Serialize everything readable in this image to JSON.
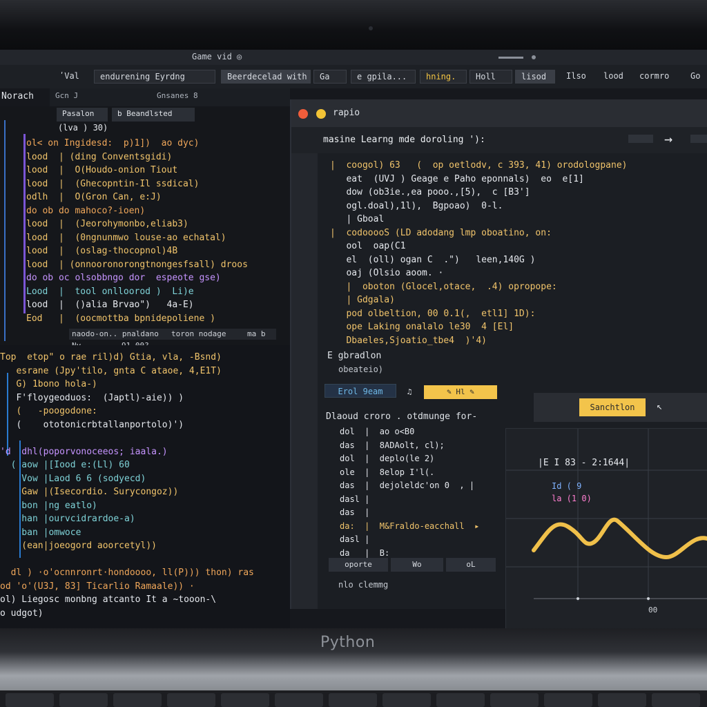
{
  "window": {
    "title": "Game vid ◎"
  },
  "menubar": {
    "items": [
      {
        "label": "ʹVal"
      },
      {
        "label": "endurening  Eyrdng"
      },
      {
        "label": "Beerdecelad with"
      },
      {
        "label": "Ga"
      },
      {
        "label": "e gpila..."
      },
      {
        "label": "hning."
      },
      {
        "label": "Holl"
      },
      {
        "label": "lisod"
      },
      {
        "label": "Ilso"
      },
      {
        "label": "lood"
      },
      {
        "label": "cormro"
      },
      {
        "label": "Go"
      }
    ]
  },
  "left_header": {
    "label": "Norach"
  },
  "left_toolbar": {
    "item1": "Gcn  J",
    "item2": "Gnsanes  8",
    "tab1": "Pasalon",
    "tab2": "b Beandlsted",
    "small": "(lva ) 30)"
  },
  "left_code": [
    {
      "t": "ol< on Ingidesd:  p)1])  ao dyc)",
      "c": "c-o"
    },
    {
      "t": "lood  | (ding Conventsgidi)",
      "c": "c-y"
    },
    {
      "t": "lood  |  O(Houdo-onion Tiout",
      "c": "c-y"
    },
    {
      "t": "lood  |  (Ghecopntin-Il ssdical)",
      "c": "c-y"
    },
    {
      "t": "odlh  |  O(Gron Can, e:J)",
      "c": "c-y"
    },
    {
      "t": "do ob do mahoco?-ioen)",
      "c": "c-o"
    },
    {
      "t": "lood  |  (Jeorohymonbo,eliab3)",
      "c": "c-y"
    },
    {
      "t": "lood  |  (0ngnunmwo louse-ao echatal)",
      "c": "c-y"
    },
    {
      "t": "lood  |  (oslag-thocopnol)4B",
      "c": "c-y"
    },
    {
      "t": "lood  | (onnooronorongtnongesfsall) droos",
      "c": "c-y"
    },
    {
      "t": "do ob oc olsobbngo dor  espeote gse)",
      "c": "c-m"
    },
    {
      "t": "Lood  |  tool onlloorod )  Li)e",
      "c": "c-c"
    },
    {
      "t": "lood  |  ()alia Brvao\")   4a-E)",
      "c": "c-w"
    },
    {
      "t": "Eod   |  (oocmottba bpnidepoliene )",
      "c": "c-y"
    }
  ],
  "left_status": {
    "a": "naodo-on.. pnaldano",
    "b": "toron nodage",
    "c": "ma b",
    "d": "Ny",
    "e": "91 00?"
  },
  "lower_code": [
    {
      "t": "Top  etop\" o rae ril)d) Gtia, vla, -Bsnd)",
      "c": "c-y"
    },
    {
      "t": "   esrane (Jpy'tilo, gnta C ataoe, 4,E1T)",
      "c": "c-y"
    },
    {
      "t": "   G) 1bono hola-)",
      "c": "c-y"
    },
    {
      "t": "   F'floygeoduos:  (Japtl)-aie)) )",
      "c": "c-w"
    },
    {
      "t": "   (   -poogodone:",
      "c": "c-y"
    },
    {
      "t": "   (    ototonicrbtallanportolo)')",
      "c": "c-w"
    },
    {
      "t": "",
      "c": "c-w"
    },
    {
      "t": "'d  dhl(poporvonoceeos; iaala.)",
      "c": "c-m"
    },
    {
      "t": "  ( aow |[Iood e:(Ll) 60",
      "c": "c-c"
    },
    {
      "t": "    Vow |Laod 6 6 (sodyecd)",
      "c": "c-c"
    },
    {
      "t": "    Gaw |(Isecordio. Surycongoz))",
      "c": "c-y"
    },
    {
      "t": "    bon |ng eatlo)",
      "c": "c-c"
    },
    {
      "t": "    han |ourvcidrardoe-a)",
      "c": "c-c"
    },
    {
      "t": "    ban |omwoce",
      "c": "c-c"
    },
    {
      "t": "    (ean|joeogord aoorcetyl))",
      "c": "c-y"
    },
    {
      "t": "",
      "c": "c-w"
    },
    {
      "t": "  dl ) ·o'ocnnronrt·hondoooo, ll(P))) thon) ras",
      "c": "c-o"
    },
    {
      "t": "od 'o'(U3J, 83] Ticarlio Ramaale)) ·",
      "c": "c-o"
    },
    {
      "t": "ol) Liegosc monbng atcanto It a ~tooon-\\",
      "c": "c-w"
    },
    {
      "t": "o udgot)",
      "c": "c-w"
    }
  ],
  "right_window": {
    "title": "rapio",
    "subtitle": "masine  Learng  mde  doroling  '): ",
    "code": [
      {
        "t": "|  coogol) 63   (  op oetlodv, c 393, 41) orodologpane)",
        "c": "c-y"
      },
      {
        "t": "   eat  (UVJ ) Geage e Paho eponnals)  eo  e[1]",
        "c": "c-w"
      },
      {
        "t": "   dow (ob3ie.,ea pooo.,[5),  c [B3']",
        "c": "c-w"
      },
      {
        "t": "   ogl.doal),1l),  Bgpoao)  0-l.",
        "c": "c-w"
      },
      {
        "t": "   | Gboal",
        "c": "c-w"
      },
      {
        "t": "|  codooooS (LD adodang lmp oboatino, on:",
        "c": "c-y"
      },
      {
        "t": "   ool  oap(C1",
        "c": "c-w"
      },
      {
        "t": "   el  (oll) ogan C  .\")   leen,140G )",
        "c": "c-w"
      },
      {
        "t": "   oaj (Olsio aoom. ·",
        "c": "c-w"
      },
      {
        "t": "   |  oboton (Glocel,otace,  .4) opropope:",
        "c": "c-y"
      },
      {
        "t": "   | Gdgala)",
        "c": "c-y"
      },
      {
        "t": "   pod olbeltion, 00 0.1(,  etl1] 1D):",
        "c": "c-y"
      },
      {
        "t": "   ope Laking onalalo le30  4 [El]",
        "c": "c-y"
      },
      {
        "t": "   Dbaeles,Sjoatio_tbe4  )'4)",
        "c": "c-y"
      }
    ],
    "explain_title": "E gbradlon",
    "explain_sub": "obeateio)",
    "btn_left": "Erol 9eam",
    "btn_left_icon": "♫",
    "btn_yellow": "✎  Hl  ✎",
    "section": "Dlaoud  croro . otdmunge  for-",
    "code2": [
      {
        "t": "dol  |  ao o<B0",
        "c": "c-w"
      },
      {
        "t": "das  |  8ADAolt, cl);",
        "c": "c-w"
      },
      {
        "t": "dol  |  deplo(le 2)",
        "c": "c-w"
      },
      {
        "t": "ole  |  8elop I'l(.",
        "c": "c-w"
      },
      {
        "t": "das  |  dejoleldc'on 0  , |",
        "c": "c-w"
      },
      {
        "t": "dasl |",
        "c": "c-w"
      },
      {
        "t": "das  |",
        "c": "c-w"
      },
      {
        "t": "da:  |  M&Fraldo-eacchall  ▸",
        "c": "c-y"
      },
      {
        "t": "dasl |",
        "c": "c-w"
      },
      {
        "t": "da   |  B:",
        "c": "c-w"
      }
    ],
    "bottom_buttons": [
      "oporte",
      "Wo",
      "oL"
    ],
    "footer": "nlo  clemmg"
  },
  "plot": {
    "search_btn": "Sanchtlon",
    "readout": "|E I 83 - 2:1644|",
    "legend1": "Id  ( 9",
    "legend2": "la (1 0)",
    "x_label": "00",
    "line_color": "#f0c04a"
  },
  "brand": "Python"
}
